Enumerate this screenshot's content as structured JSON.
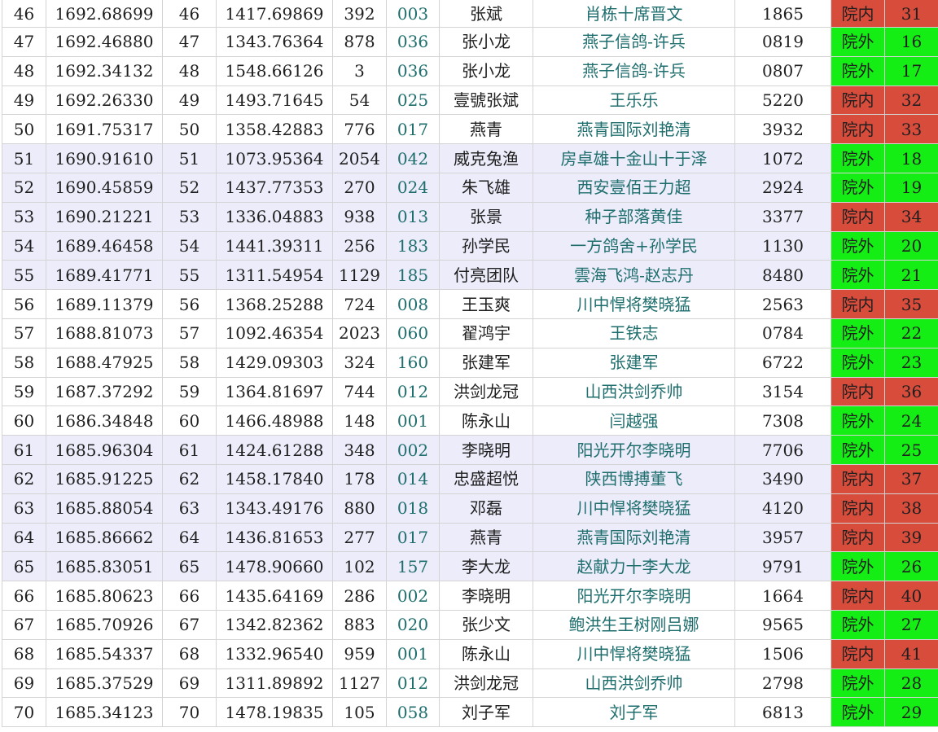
{
  "colors": {
    "band": "#ececfa",
    "status_inner": "#d84c3b",
    "status_outer": "#14ee14",
    "code_text": "#1f6e6e",
    "grid": "#d4d4d4"
  },
  "rows": [
    {
      "rank": "46",
      "speed": "1692.68699",
      "rank2": "46",
      "speed2": "1417.69869",
      "num": "392",
      "code": "003",
      "name": "张斌",
      "team": "肖栋十席晋文",
      "ring": "1865",
      "status": "院内",
      "count": "31",
      "band": false
    },
    {
      "rank": "47",
      "speed": "1692.46880",
      "rank2": "47",
      "speed2": "1343.76364",
      "num": "878",
      "code": "036",
      "name": "张小龙",
      "team": "燕子信鸽-许兵",
      "ring": "0819",
      "status": "院外",
      "count": "16",
      "band": false
    },
    {
      "rank": "48",
      "speed": "1692.34132",
      "rank2": "48",
      "speed2": "1548.66126",
      "num": "3",
      "code": "036",
      "name": "张小龙",
      "team": "燕子信鸽-许兵",
      "ring": "0807",
      "status": "院外",
      "count": "17",
      "band": false
    },
    {
      "rank": "49",
      "speed": "1692.26330",
      "rank2": "49",
      "speed2": "1493.71645",
      "num": "54",
      "code": "025",
      "name": "壹號张斌",
      "team": "王乐乐",
      "ring": "5220",
      "status": "院内",
      "count": "32",
      "band": false
    },
    {
      "rank": "50",
      "speed": "1691.75317",
      "rank2": "50",
      "speed2": "1358.42883",
      "num": "776",
      "code": "017",
      "name": "燕青",
      "team": "燕青国际刘艳清",
      "ring": "3932",
      "status": "院内",
      "count": "33",
      "band": false
    },
    {
      "rank": "51",
      "speed": "1690.91610",
      "rank2": "51",
      "speed2": "1073.95364",
      "num": "2054",
      "code": "042",
      "name": "威克兔渔",
      "team": "房卓雄十金山十于泽",
      "ring": "1072",
      "status": "院外",
      "count": "18",
      "band": true
    },
    {
      "rank": "52",
      "speed": "1690.45859",
      "rank2": "52",
      "speed2": "1437.77353",
      "num": "270",
      "code": "024",
      "name": "朱飞雄",
      "team": "西安壹佰王力超",
      "ring": "2924",
      "status": "院外",
      "count": "19",
      "band": true
    },
    {
      "rank": "53",
      "speed": "1690.21221",
      "rank2": "53",
      "speed2": "1336.04883",
      "num": "938",
      "code": "013",
      "name": "张景",
      "team": "种子部落黄佳",
      "ring": "3377",
      "status": "院内",
      "count": "34",
      "band": true
    },
    {
      "rank": "54",
      "speed": "1689.46458",
      "rank2": "54",
      "speed2": "1441.39311",
      "num": "256",
      "code": "183",
      "name": "孙学民",
      "team": "一方鸽舍+孙学民",
      "ring": "1130",
      "status": "院外",
      "count": "20",
      "band": true
    },
    {
      "rank": "55",
      "speed": "1689.41771",
      "rank2": "55",
      "speed2": "1311.54954",
      "num": "1129",
      "code": "185",
      "name": "付亮团队",
      "team": "雲海飞鸿-赵志丹",
      "ring": "8480",
      "status": "院外",
      "count": "21",
      "band": true
    },
    {
      "rank": "56",
      "speed": "1689.11379",
      "rank2": "56",
      "speed2": "1368.25288",
      "num": "724",
      "code": "008",
      "name": "王玉爽",
      "team": "川中悍将樊晓猛",
      "ring": "2563",
      "status": "院内",
      "count": "35",
      "band": false
    },
    {
      "rank": "57",
      "speed": "1688.81073",
      "rank2": "57",
      "speed2": "1092.46354",
      "num": "2023",
      "code": "060",
      "name": "翟鸿宇",
      "team": "王铁志",
      "ring": "0784",
      "status": "院外",
      "count": "22",
      "band": false
    },
    {
      "rank": "58",
      "speed": "1688.47925",
      "rank2": "58",
      "speed2": "1429.09303",
      "num": "324",
      "code": "160",
      "name": "张建军",
      "team": "张建军",
      "ring": "6722",
      "status": "院外",
      "count": "23",
      "band": false
    },
    {
      "rank": "59",
      "speed": "1687.37292",
      "rank2": "59",
      "speed2": "1364.81697",
      "num": "744",
      "code": "012",
      "name": "洪剑龙冠",
      "team": "山西洪剑乔帅",
      "ring": "3154",
      "status": "院内",
      "count": "36",
      "band": false
    },
    {
      "rank": "60",
      "speed": "1686.34848",
      "rank2": "60",
      "speed2": "1466.48988",
      "num": "148",
      "code": "001",
      "name": "陈永山",
      "team": "闫越强",
      "ring": "7308",
      "status": "院外",
      "count": "24",
      "band": false
    },
    {
      "rank": "61",
      "speed": "1685.96304",
      "rank2": "61",
      "speed2": "1424.61288",
      "num": "348",
      "code": "002",
      "name": "李晓明",
      "team": "阳光开尔李晓明",
      "ring": "7706",
      "status": "院外",
      "count": "25",
      "band": true
    },
    {
      "rank": "62",
      "speed": "1685.91225",
      "rank2": "62",
      "speed2": "1458.17840",
      "num": "178",
      "code": "014",
      "name": "忠盛超悦",
      "team": "陕西博搏董飞",
      "ring": "3490",
      "status": "院内",
      "count": "37",
      "band": true
    },
    {
      "rank": "63",
      "speed": "1685.88054",
      "rank2": "63",
      "speed2": "1343.49176",
      "num": "880",
      "code": "018",
      "name": "邓磊",
      "team": "川中悍将樊晓猛",
      "ring": "4120",
      "status": "院内",
      "count": "38",
      "band": true
    },
    {
      "rank": "64",
      "speed": "1685.86662",
      "rank2": "64",
      "speed2": "1436.81653",
      "num": "277",
      "code": "017",
      "name": "燕青",
      "team": "燕青国际刘艳清",
      "ring": "3957",
      "status": "院内",
      "count": "39",
      "band": true
    },
    {
      "rank": "65",
      "speed": "1685.83051",
      "rank2": "65",
      "speed2": "1478.90660",
      "num": "102",
      "code": "157",
      "name": "李大龙",
      "team": "赵献力十李大龙",
      "ring": "9791",
      "status": "院外",
      "count": "26",
      "band": true
    },
    {
      "rank": "66",
      "speed": "1685.80623",
      "rank2": "66",
      "speed2": "1435.64169",
      "num": "286",
      "code": "002",
      "name": "李晓明",
      "team": "阳光开尔李晓明",
      "ring": "1664",
      "status": "院内",
      "count": "40",
      "band": false
    },
    {
      "rank": "67",
      "speed": "1685.70926",
      "rank2": "67",
      "speed2": "1342.82362",
      "num": "883",
      "code": "020",
      "name": "张少文",
      "team": "鲍洪生王树刚吕娜",
      "ring": "9565",
      "status": "院外",
      "count": "27",
      "band": false
    },
    {
      "rank": "68",
      "speed": "1685.54337",
      "rank2": "68",
      "speed2": "1332.96540",
      "num": "959",
      "code": "001",
      "name": "陈永山",
      "team": "川中悍将樊晓猛",
      "ring": "1506",
      "status": "院内",
      "count": "41",
      "band": false
    },
    {
      "rank": "69",
      "speed": "1685.37529",
      "rank2": "69",
      "speed2": "1311.89892",
      "num": "1127",
      "code": "012",
      "name": "洪剑龙冠",
      "team": "山西洪剑乔帅",
      "ring": "2798",
      "status": "院外",
      "count": "28",
      "band": false
    },
    {
      "rank": "70",
      "speed": "1685.34123",
      "rank2": "70",
      "speed2": "1478.19835",
      "num": "105",
      "code": "058",
      "name": "刘子军",
      "team": "刘子军",
      "ring": "6813",
      "status": "院外",
      "count": "29",
      "band": false
    }
  ]
}
